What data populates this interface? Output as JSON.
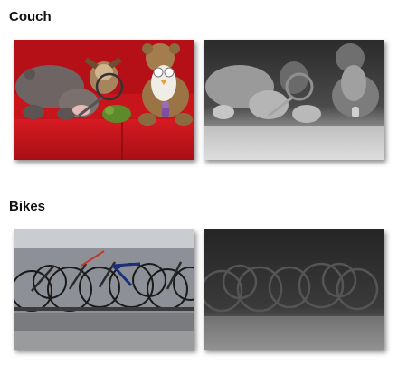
{
  "sections": [
    {
      "title": "Couch"
    },
    {
      "title": "Bikes"
    }
  ],
  "colors": {
    "couch_red": "#c8141b",
    "depth_dark": "#2b2b2b",
    "depth_light": "#e8e8e8",
    "bike_frame_blue": "#1c2f7a"
  },
  "images": {
    "couch_photo": "couch-photo",
    "couch_depth": "couch-depth-map",
    "bikes_photo": "bikes-photo",
    "bikes_depth": "bikes-depth-map"
  }
}
